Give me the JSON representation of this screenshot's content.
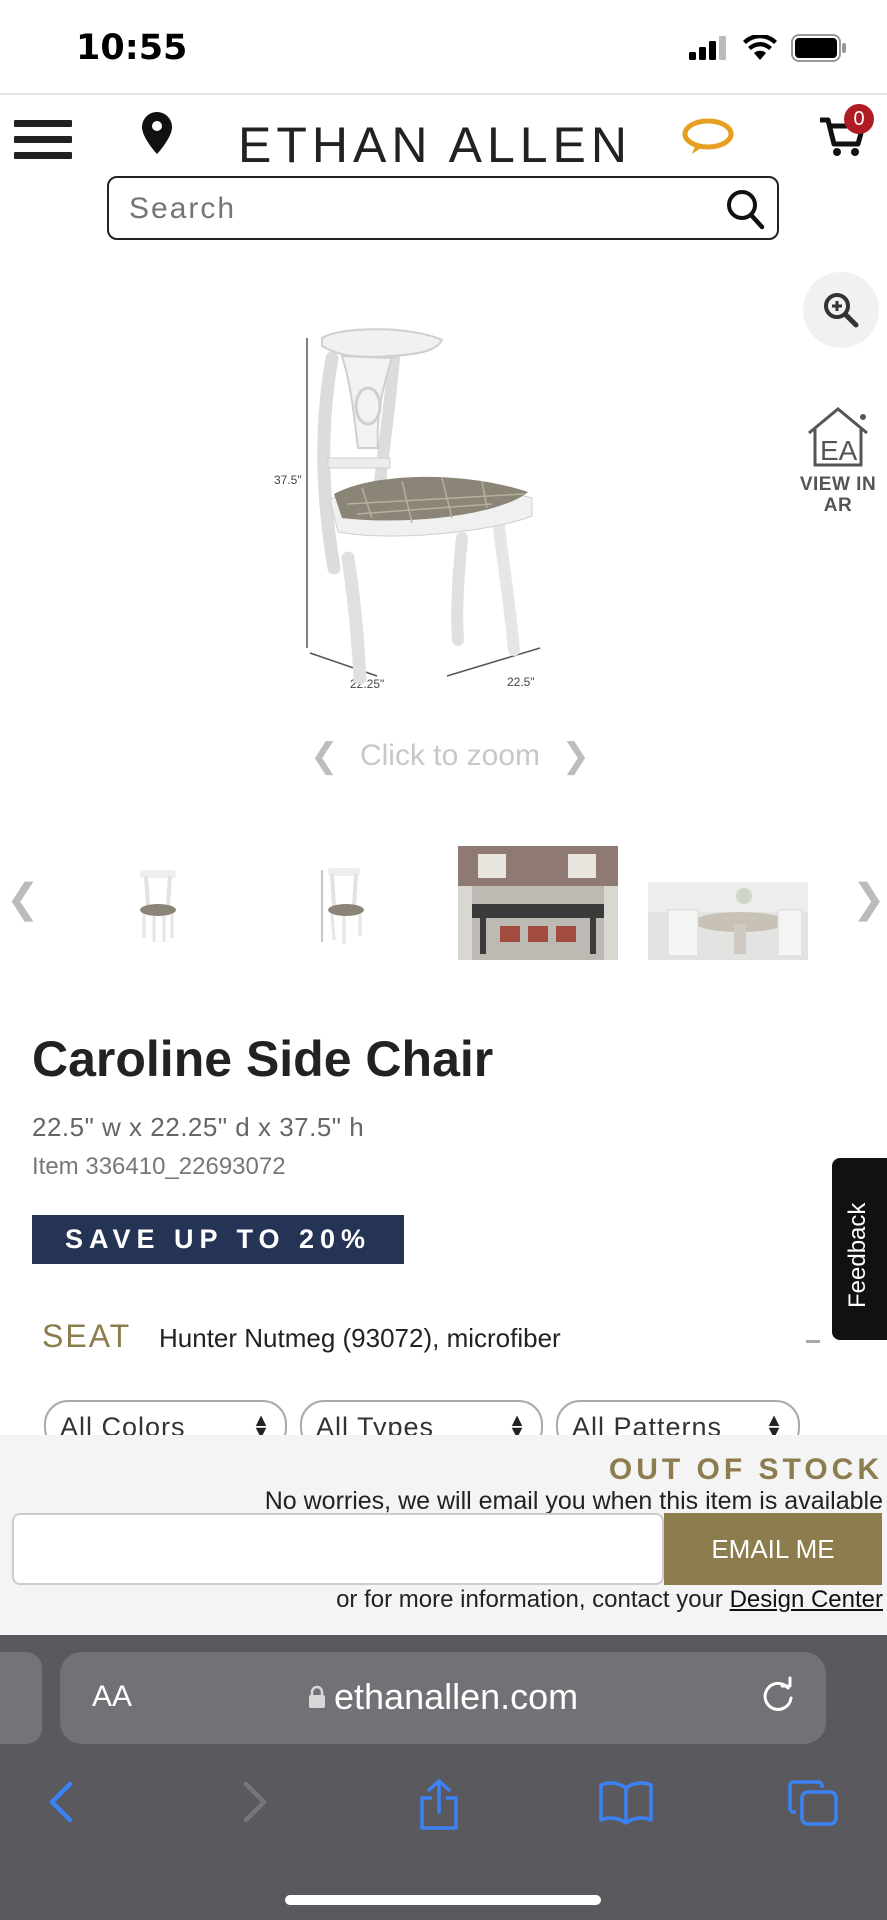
{
  "status_bar": {
    "time": "10:55"
  },
  "header": {
    "logo": "ETHAN ALLEN",
    "cart_count": "0",
    "search": {
      "placeholder": "Search"
    }
  },
  "media": {
    "zoom_hint": "Click to zoom",
    "view_in_ar": "VIEW IN AR",
    "ar_logo": "EA",
    "dimension_labels": {
      "height": "37.5\"",
      "depth": "22.25\"",
      "width": "22.5\""
    },
    "thumbnail_count": 4
  },
  "product": {
    "title": "Caroline Side Chair",
    "dimensions": "22.5\" w x 22.25\" d x 37.5\" h",
    "item": "Item 336410_22693072",
    "promo": "SAVE UP TO 20%",
    "seat_label": "SEAT",
    "seat_value": "Hunter Nutmeg (93072), microfiber"
  },
  "filters": [
    "All Colors",
    "All Types",
    "All Patterns"
  ],
  "feedback": "Feedback",
  "out_of_stock": {
    "title": "OUT OF STOCK",
    "subtitle": "No worries, we will email you when this item is available",
    "email_placeholder": "",
    "button": "EMAIL ME",
    "contact_prefix": "or for more information, contact your",
    "contact_link": "Design Center"
  },
  "browser": {
    "aa": "AA",
    "url": "ethanallen.com"
  },
  "colors": {
    "navy": "#253354",
    "gold": "#8c7c4e",
    "badge_red": "#b01c24",
    "chat_orange": "#e5a020",
    "browser_blue": "#3b82f6"
  }
}
